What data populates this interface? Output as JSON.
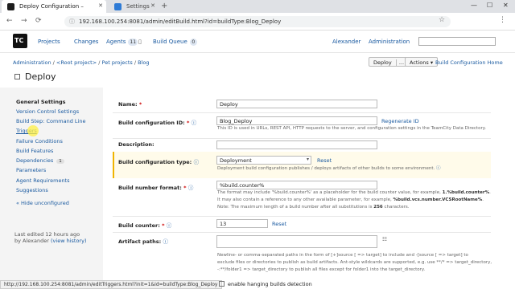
{
  "browser": {
    "tabs": [
      {
        "title": "Deploy Configuration –",
        "active": true
      },
      {
        "title": "Settings",
        "active": false
      }
    ],
    "url": "192.168.100.254:8081/admin/editBuild.html?id=buildType:Blog_Deploy"
  },
  "header": {
    "logo": "TC",
    "nav": {
      "projects": "Projects",
      "changes": "Changes",
      "agents": "Agents",
      "agents_count": "11",
      "build_queue": "Build Queue",
      "queue_count": "0"
    },
    "user": "Alexander",
    "administration": "Administration"
  },
  "breadcrumb": [
    "Administration",
    "<Root project>",
    "Pet projects",
    "Blog"
  ],
  "top_buttons": {
    "deploy": "Deploy",
    "deploy_more": "...",
    "actions": "Actions",
    "home": "Build Configuration Home"
  },
  "page_title": "Deploy",
  "sidebar": {
    "items": [
      {
        "label": "General Settings",
        "selected": true
      },
      {
        "label": "Version Control Settings"
      },
      {
        "label": "Build Step: Command Line"
      },
      {
        "label": "Triggers"
      },
      {
        "label": "Failure Conditions"
      },
      {
        "label": "Build Features"
      },
      {
        "label": "Dependencies",
        "badge": "1"
      },
      {
        "label": "Parameters"
      },
      {
        "label": "Agent Requirements"
      },
      {
        "label": "Suggestions"
      },
      {
        "label": "« Hide unconfigured"
      }
    ],
    "last_edited": "Last edited 12 hours ago",
    "by_user": "by Alexander",
    "view_history": "(view history)"
  },
  "form": {
    "name_label": "Name:",
    "name_value": "Deploy",
    "id_label": "Build configuration ID:",
    "id_value": "Blog_Deploy",
    "regenerate_id": "Regenerate ID",
    "id_hint": "This ID is used in URLs, REST API, HTTP requests to the server, and configuration settings in the TeamCity Data Directory.",
    "description_label": "Description:",
    "type_label": "Build configuration type:",
    "type_value": "Deployment",
    "type_reset": "Reset",
    "type_hint": "Deployment build configuration publishes / deploys artifacts of other builds to some environment.",
    "number_label": "Build number format:",
    "number_value": "%build.counter%",
    "number_hint1_pre": "The format may include '%build.counter%' as a placeholder for the build counter value, for example,",
    "number_hint1_ex": "1.%build.counter%",
    "number_hint2_pre": "It may also contain a reference to any other available parameter, for example,",
    "number_hint2_ex": "%build.vcs.number.VCSRootName%",
    "number_hint3_pre": "Note: The maximum length of a build number after all substitutions is",
    "number_hint3_max": "256",
    "number_hint3_post": "characters.",
    "counter_label": "Build counter:",
    "counter_value": "13",
    "counter_reset": "Reset",
    "artifacts_label": "Artifact paths:",
    "artifacts_hint1": "Newline- or comma-separated paths in the form of [+]source [ => target] to include and -[source [ => target] to",
    "artifacts_hint2": "exclude files or directories to publish as build artifacts. Ant-style wildcards are supported, e.g. use **/* => target_directory,",
    "artifacts_hint3": "-:**/folder1 => target_directory to publish all files except for folder1 into the target_directory."
  },
  "statusbar_url": "http://192.168.100.254:8081/admin/editTriggers.html?init=1&id=buildType:Blog_Deploy",
  "hanging_detection": "enable hanging builds detection"
}
